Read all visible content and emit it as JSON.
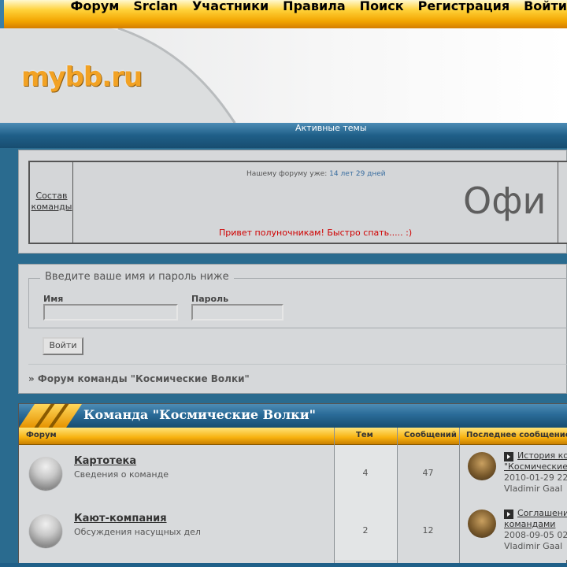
{
  "topnav": {
    "items": [
      "Форум",
      "Srclan",
      "Участники",
      "Правила",
      "Поиск",
      "Регистрация",
      "Войти"
    ]
  },
  "header": {
    "logo_text": "mybb.ru"
  },
  "bluebar": {
    "active_topics": "Активные темы"
  },
  "announcement": {
    "team_link": "Состав команды",
    "since_label": "Нашему форуму уже:",
    "since_value": "14 лет 29 дней",
    "big_text": "Офи",
    "greeting": "Привет полуночникам! Быстро спать..... :)"
  },
  "login": {
    "legend": "Введите ваше имя и пароль ниже",
    "name_label": "Имя",
    "password_label": "Пароль",
    "submit_label": "Войти",
    "name_value": "",
    "password_value": ""
  },
  "breadcrumb": {
    "text": "» Форум команды \"Космические Волки\""
  },
  "category": {
    "title": "Команда \"Космические Волки\"",
    "columns": {
      "forum": "Форум",
      "topics": "Тем",
      "posts": "Сообщений",
      "last_post": "Последнее сообщение"
    },
    "forums": [
      {
        "name": "Картотека",
        "desc": "Сведения о команде",
        "topics": "4",
        "posts": "47",
        "last_title_1": "История ко",
        "last_title_2": "\"Космические",
        "last_date": "2010-01-29 22",
        "last_author": "Vladimir Gaal"
      },
      {
        "name": "Кают-компания",
        "desc": "Обсуждения насущных дел",
        "topics": "2",
        "posts": "12",
        "last_title_1": "Соглашени",
        "last_title_2": "командами",
        "last_date": "2008-09-05 02",
        "last_author": "Vladimir Gaal"
      }
    ]
  },
  "colors": {
    "orange": "#f7b10f",
    "blue": "#2a6b98",
    "red_text": "#d00000"
  }
}
